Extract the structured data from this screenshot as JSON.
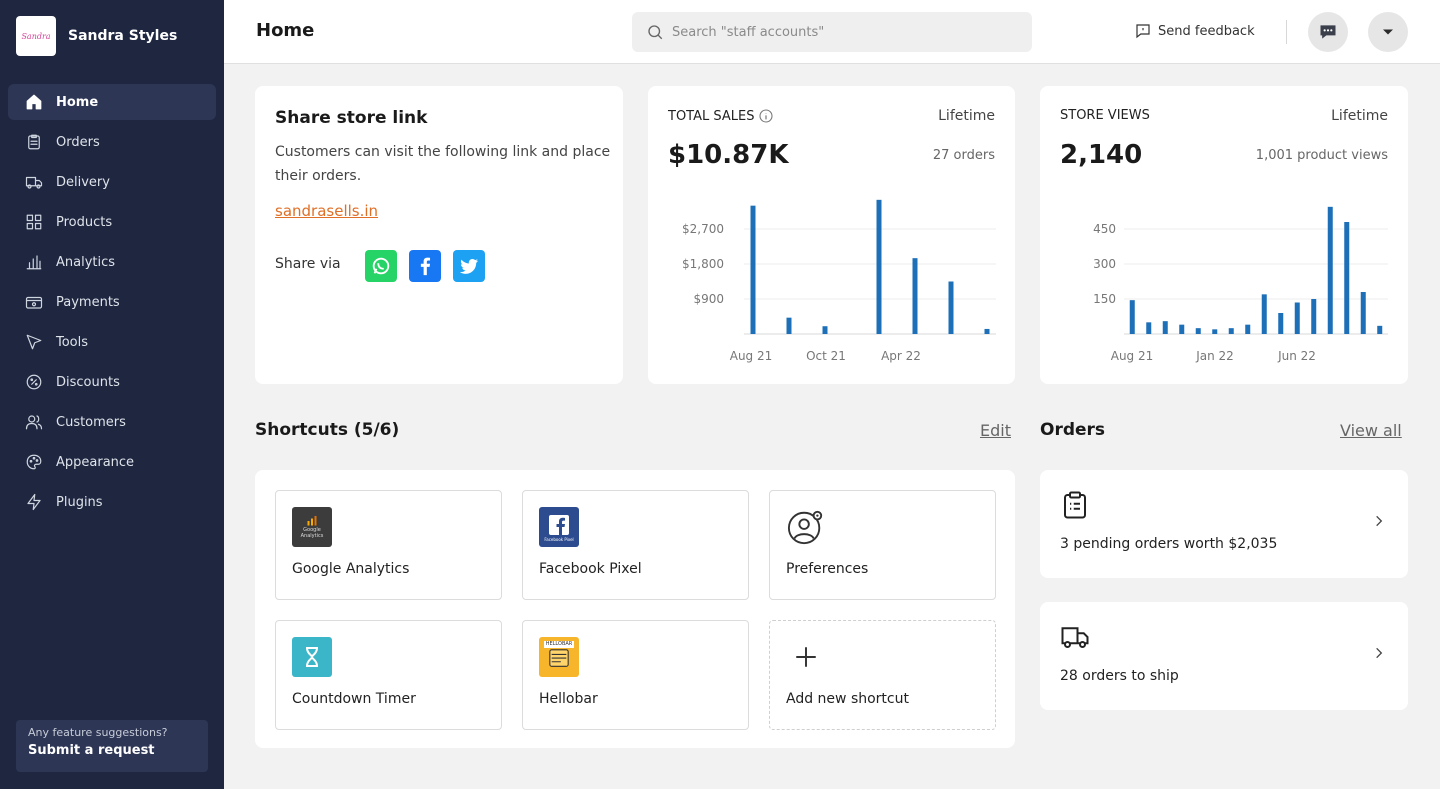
{
  "brand": {
    "name": "Sandra Styles",
    "logo_text": "Sandra"
  },
  "sidebar": {
    "items": [
      {
        "label": "Home"
      },
      {
        "label": "Orders"
      },
      {
        "label": "Delivery"
      },
      {
        "label": "Products"
      },
      {
        "label": "Analytics"
      },
      {
        "label": "Payments"
      },
      {
        "label": "Tools"
      },
      {
        "label": "Discounts"
      },
      {
        "label": "Customers"
      },
      {
        "label": "Appearance"
      },
      {
        "label": "Plugins"
      }
    ],
    "suggestion_question": "Any feature suggestions?",
    "suggestion_action": "Submit a request"
  },
  "header": {
    "title": "Home",
    "search_placeholder": "Search \"staff accounts\"",
    "feedback_label": "Send feedback"
  },
  "share": {
    "title": "Share store link",
    "description": "Customers can visit the following link and place their orders.",
    "link": "sandrasells.in",
    "via_label": "Share via"
  },
  "total_sales": {
    "label": "TOTAL SALES",
    "period": "Lifetime",
    "value": "$10.87K",
    "sub": "27 orders"
  },
  "store_views": {
    "label": "STORE VIEWS",
    "period": "Lifetime",
    "value": "2,140",
    "sub": "1,001 product views"
  },
  "chart_data": [
    {
      "type": "bar",
      "y_ticks": [
        900,
        1800,
        2700
      ],
      "y_tick_labels": [
        "$900",
        "$1,800",
        "$2,700"
      ],
      "x_tick_labels": [
        "Aug 21",
        "Oct 21",
        "Apr 22"
      ],
      "ylim": [
        0,
        3600
      ],
      "values": [
        3300,
        0,
        420,
        0,
        200,
        0,
        0,
        3450,
        0,
        1950,
        0,
        1350,
        0,
        130
      ],
      "grid": true,
      "color": "#1d6fb8"
    },
    {
      "type": "bar",
      "y_ticks": [
        150,
        300,
        450
      ],
      "y_tick_labels": [
        "150",
        "300",
        "450"
      ],
      "x_tick_labels": [
        "Aug 21",
        "Jan 22",
        "Jun 22"
      ],
      "ylim": [
        0,
        600
      ],
      "values": [
        145,
        50,
        55,
        40,
        25,
        20,
        25,
        40,
        170,
        90,
        135,
        150,
        545,
        480,
        180,
        35
      ],
      "grid": true,
      "color": "#1d6fb8"
    }
  ],
  "shortcuts": {
    "title": "Shortcuts (5/6)",
    "edit_label": "Edit",
    "items": [
      {
        "label": "Google Analytics",
        "icon": "google-analytics-icon",
        "icon_text": "Google Analytics"
      },
      {
        "label": "Facebook Pixel",
        "icon": "facebook-pixel-icon",
        "icon_text": "Facebook Pixel"
      },
      {
        "label": "Preferences",
        "icon": "preferences-icon"
      },
      {
        "label": "Countdown Timer",
        "icon": "hourglass-icon"
      },
      {
        "label": "Hellobar",
        "icon": "hellobar-icon",
        "icon_text": "HELLOBAR"
      },
      {
        "label": "Add new shortcut",
        "icon": "plus-icon"
      }
    ]
  },
  "orders": {
    "title": "Orders",
    "view_all_label": "View all",
    "pending_text": "3 pending orders worth $2,035",
    "ship_text": "28 orders to ship"
  },
  "colors": {
    "sidebar_bg": "#1e2640",
    "accent_link": "#e06f26",
    "bar": "#1d6fb8",
    "whatsapp": "#25d366",
    "facebook": "#1877f2",
    "twitter": "#1da1f2"
  }
}
